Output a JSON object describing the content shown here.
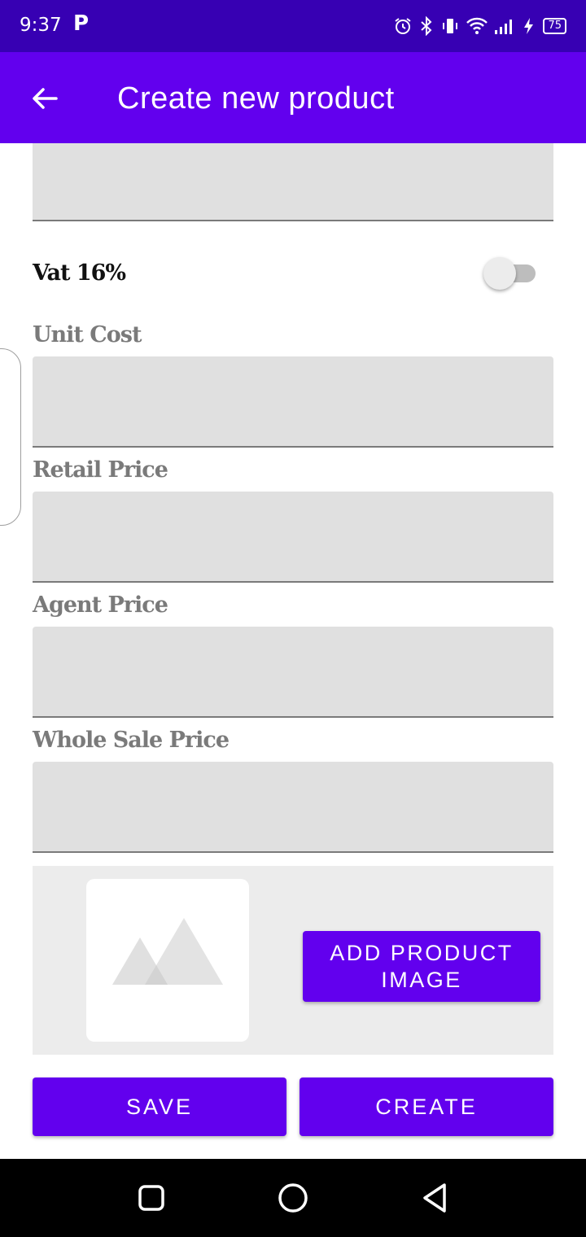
{
  "status_bar": {
    "time": "9:37",
    "app_indicator": "P",
    "battery": "75",
    "icons": [
      "alarm-icon",
      "bluetooth-icon",
      "vibrate-icon",
      "wifi-icon",
      "signal-icon",
      "charging-icon",
      "battery-icon"
    ]
  },
  "app_bar": {
    "title": "Create new product",
    "back_icon": "arrow-left-icon"
  },
  "form": {
    "vat_label": "Vat 16%",
    "vat_enabled": false,
    "fields": [
      {
        "label": "Unit Cost",
        "value": ""
      },
      {
        "label": "Retail Price",
        "value": ""
      },
      {
        "label": "Agent Price",
        "value": ""
      },
      {
        "label": "Whole Sale Price",
        "value": ""
      }
    ]
  },
  "image_section": {
    "placeholder_icon": "image-placeholder-icon",
    "add_image_label": "ADD PRODUCT IMAGE"
  },
  "actions": {
    "save_label": "SAVE",
    "create_label": "CREATE"
  },
  "nav_bar": {
    "icons": [
      "recents-icon",
      "home-icon",
      "back-icon"
    ]
  },
  "colors": {
    "status_bar": "#3700b3",
    "primary": "#6200ee",
    "field_bg": "#e0e0e0",
    "label_gray": "#7a7a7a"
  }
}
